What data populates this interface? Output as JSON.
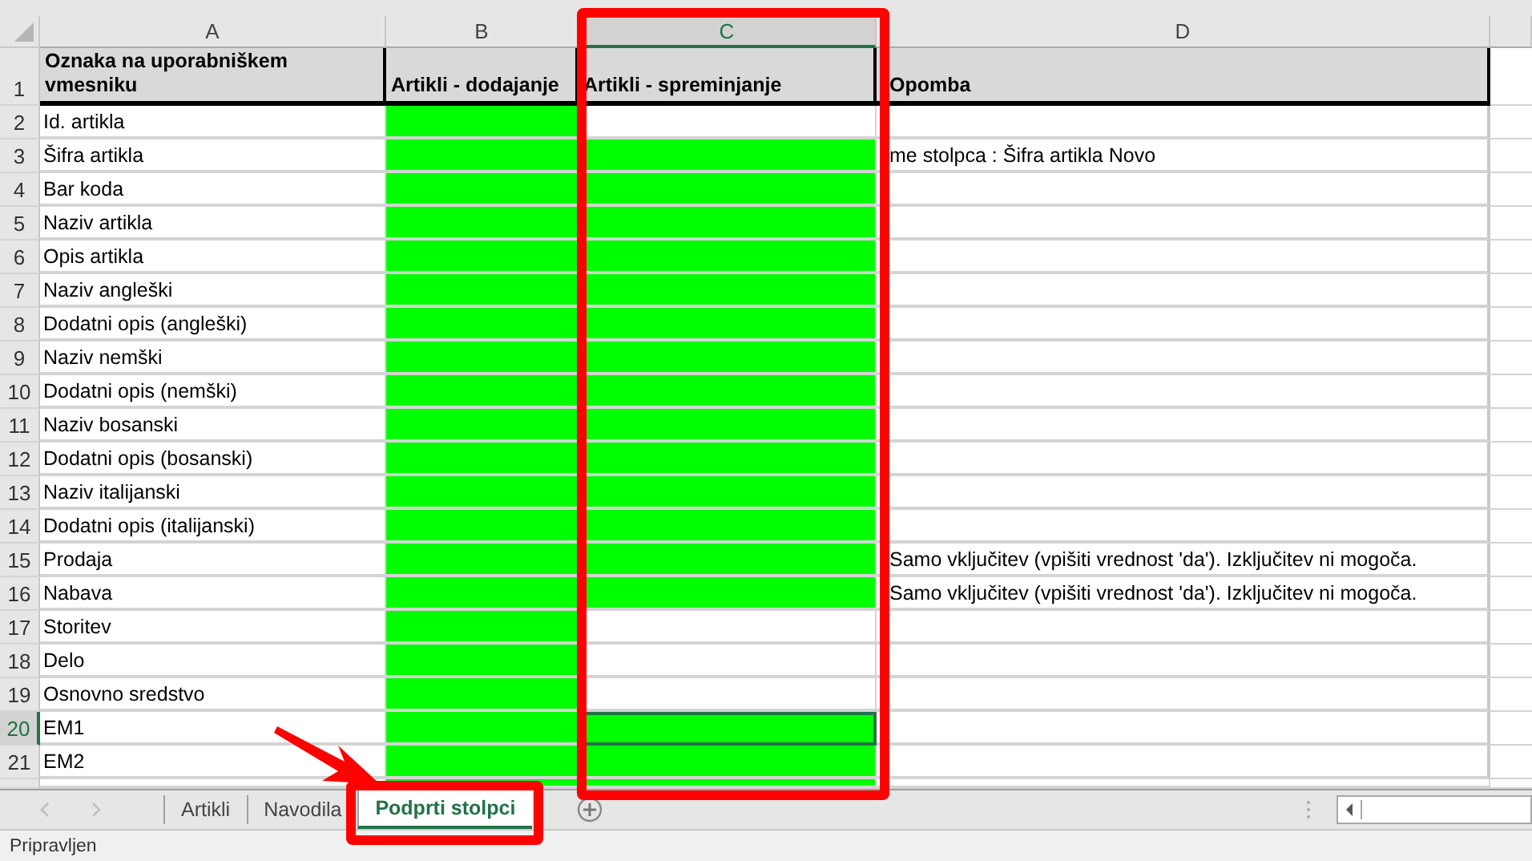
{
  "columns": [
    {
      "label": "A",
      "selected": false
    },
    {
      "label": "B",
      "selected": false
    },
    {
      "label": "C",
      "selected": true
    },
    {
      "label": "D",
      "selected": false
    }
  ],
  "header_row": {
    "number": "1",
    "cells": [
      "Oznaka na uporabniškem vmesniku",
      "Artikli - dodajanje",
      "Artikli - spreminjanje",
      "Opomba"
    ]
  },
  "rows": [
    {
      "number": "2",
      "a": "Id. artikla",
      "b_filled": true,
      "c_filled": false,
      "selected": false
    },
    {
      "number": "3",
      "a": "Šifra artikla",
      "b_filled": true,
      "c_filled": true,
      "d": "me stolpca : Šifra artikla Novo",
      "selected": false
    },
    {
      "number": "4",
      "a": "Bar koda",
      "b_filled": true,
      "c_filled": true,
      "selected": false
    },
    {
      "number": "5",
      "a": "Naziv artikla",
      "b_filled": true,
      "c_filled": true,
      "selected": false
    },
    {
      "number": "6",
      "a": "Opis artikla",
      "b_filled": true,
      "c_filled": true,
      "selected": false
    },
    {
      "number": "7",
      "a": "Naziv angleški",
      "b_filled": true,
      "c_filled": true,
      "selected": false
    },
    {
      "number": "8",
      "a": "Dodatni opis (angleški)",
      "b_filled": true,
      "c_filled": true,
      "selected": false
    },
    {
      "number": "9",
      "a": "Naziv nemški",
      "b_filled": true,
      "c_filled": true,
      "selected": false
    },
    {
      "number": "10",
      "a": "Dodatni opis (nemški)",
      "b_filled": true,
      "c_filled": true,
      "selected": false
    },
    {
      "number": "11",
      "a": "Naziv bosanski",
      "b_filled": true,
      "c_filled": true,
      "selected": false
    },
    {
      "number": "12",
      "a": "Dodatni opis (bosanski)",
      "b_filled": true,
      "c_filled": true,
      "selected": false
    },
    {
      "number": "13",
      "a": "Naziv italijanski",
      "b_filled": true,
      "c_filled": true,
      "selected": false
    },
    {
      "number": "14",
      "a": "Dodatni opis (italijanski)",
      "b_filled": true,
      "c_filled": true,
      "selected": false
    },
    {
      "number": "15",
      "a": "Prodaja",
      "b_filled": true,
      "c_filled": true,
      "d": "Samo vključitev (vpišiti vrednost 'da'). Izključitev ni mogoča.",
      "selected": false
    },
    {
      "number": "16",
      "a": "Nabava",
      "b_filled": true,
      "c_filled": true,
      "d": "Samo vključitev (vpišiti vrednost 'da'). Izključitev ni mogoča.",
      "selected": false
    },
    {
      "number": "17",
      "a": "Storitev",
      "b_filled": true,
      "c_filled": false,
      "selected": false
    },
    {
      "number": "18",
      "a": "Delo",
      "b_filled": true,
      "c_filled": false,
      "selected": false
    },
    {
      "number": "19",
      "a": "Osnovno sredstvo",
      "b_filled": true,
      "c_filled": false,
      "selected": false
    },
    {
      "number": "20",
      "a": "EM1",
      "b_filled": true,
      "c_filled": true,
      "selected": true
    },
    {
      "number": "21",
      "a": "EM2",
      "b_filled": true,
      "c_filled": true,
      "selected": false
    }
  ],
  "sheet_tabs": [
    {
      "label": "Artikli",
      "selected": false
    },
    {
      "label": "Navodila",
      "selected": false
    },
    {
      "label": "Podprti stolpci",
      "selected": true
    }
  ],
  "status_bar": {
    "text": "Pripravljen"
  }
}
